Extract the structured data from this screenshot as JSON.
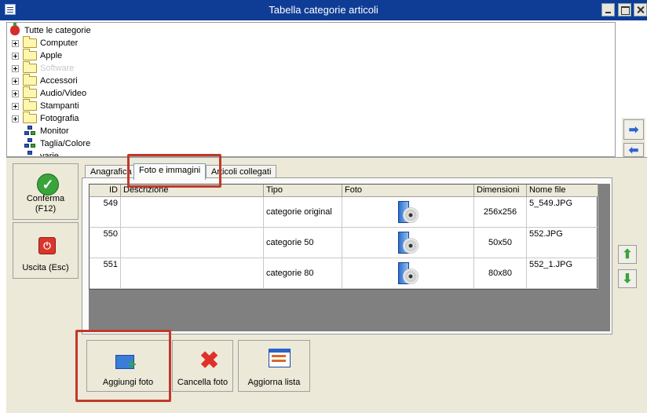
{
  "window": {
    "title": "Tabella categorie articoli"
  },
  "tree": {
    "root_label": "Tutte le categorie",
    "items": [
      {
        "label": "Computer",
        "type": "folder",
        "expandable": true
      },
      {
        "label": "Apple",
        "type": "folder",
        "expandable": true
      },
      {
        "label": "Software",
        "type": "folder",
        "expandable": true,
        "muted": true
      },
      {
        "label": "Accessori",
        "type": "folder",
        "expandable": true
      },
      {
        "label": "Audio/Video",
        "type": "folder",
        "expandable": true
      },
      {
        "label": "Stampanti",
        "type": "folder",
        "expandable": true
      },
      {
        "label": "Fotografia",
        "type": "folder",
        "expandable": true
      },
      {
        "label": "Monitor",
        "type": "node",
        "expandable": false
      },
      {
        "label": "Taglia/Colore",
        "type": "node",
        "expandable": false
      },
      {
        "label": "varie",
        "type": "node",
        "expandable": false
      }
    ]
  },
  "left_buttons": {
    "confirm": "Conferma\n(F12)",
    "exit": "Uscita (Esc)"
  },
  "tabs": [
    {
      "label": "Anagrafica",
      "active": false
    },
    {
      "label": "Foto e immagini",
      "active": true
    },
    {
      "label": "Articoli collegati",
      "active": false
    }
  ],
  "grid": {
    "columns": [
      "ID",
      "Descrizione",
      "Tipo",
      "Foto",
      "Dimensioni",
      "Nome file"
    ],
    "rows": [
      {
        "id": "549",
        "descrizione": "",
        "tipo": "categorie original",
        "foto": "cd-image-icon",
        "dimensioni": "256x256",
        "nome_file": "5_549.JPG"
      },
      {
        "id": "550",
        "descrizione": "",
        "tipo": "categorie 50",
        "foto": "cd-image-icon",
        "dimensioni": "50x50",
        "nome_file": "552.JPG"
      },
      {
        "id": "551",
        "descrizione": "",
        "tipo": "categorie 80",
        "foto": "cd-image-icon",
        "dimensioni": "80x80",
        "nome_file": "552_1.JPG"
      }
    ]
  },
  "bottom_buttons": {
    "add": "Aggiungi foto",
    "delete": "Cancella foto",
    "refresh": "Aggiorna lista"
  },
  "colors": {
    "titlebar": "#0f3d96",
    "panel": "#ece9d8",
    "highlight": "#c0392b"
  }
}
